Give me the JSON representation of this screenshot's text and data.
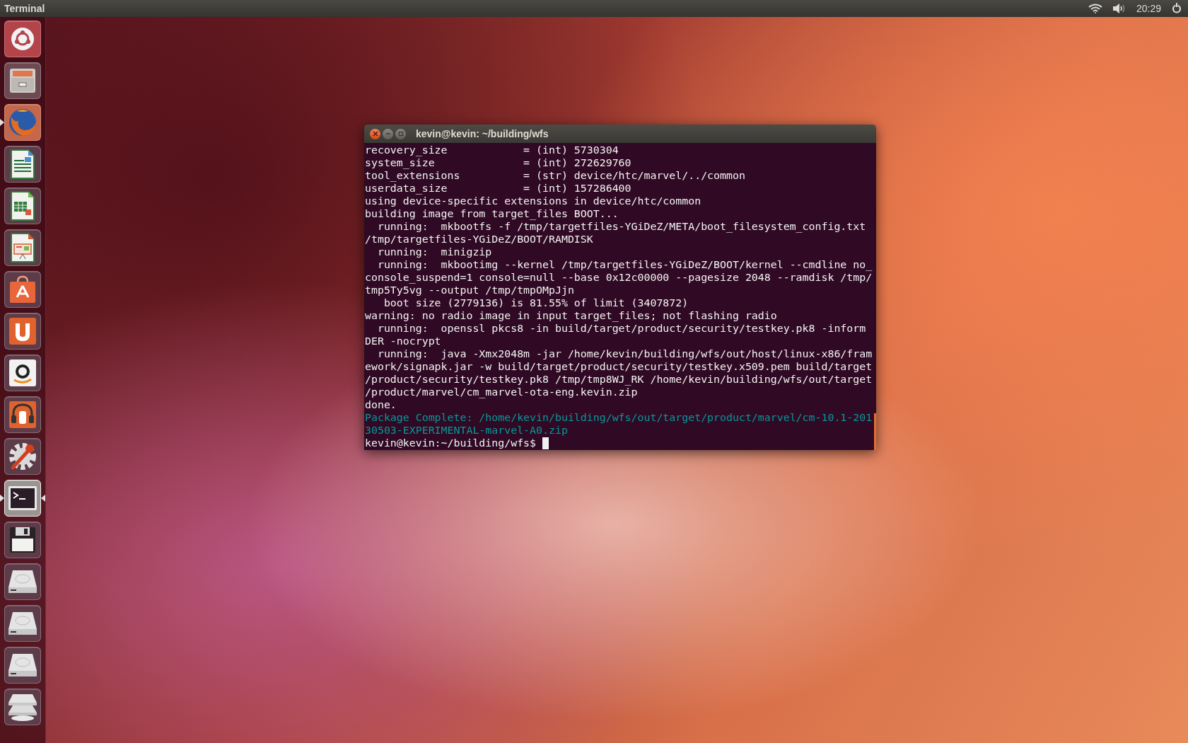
{
  "top_bar": {
    "app_title": "Terminal",
    "clock": "20:29"
  },
  "launcher": [
    {
      "kind": "ubuntu",
      "running": false,
      "focused": false
    },
    {
      "kind": "files",
      "running": false,
      "focused": false
    },
    {
      "kind": "browser",
      "running": true,
      "focused": false
    },
    {
      "kind": "writer",
      "running": false,
      "focused": false
    },
    {
      "kind": "calc",
      "running": false,
      "focused": false
    },
    {
      "kind": "impress",
      "running": false,
      "focused": false
    },
    {
      "kind": "software",
      "running": false,
      "focused": false
    },
    {
      "kind": "cloud",
      "running": false,
      "focused": false
    },
    {
      "kind": "shop",
      "running": false,
      "focused": false
    },
    {
      "kind": "music",
      "running": false,
      "focused": false
    },
    {
      "kind": "settings",
      "running": false,
      "focused": false
    },
    {
      "kind": "terminal",
      "running": true,
      "focused": true
    },
    {
      "kind": "floppy",
      "running": false,
      "focused": false
    },
    {
      "kind": "drive",
      "running": false,
      "focused": false
    },
    {
      "kind": "drive",
      "running": false,
      "focused": false
    },
    {
      "kind": "drive",
      "running": false,
      "focused": false
    },
    {
      "kind": "stack",
      "running": false,
      "focused": false
    }
  ],
  "terminal": {
    "title": "kevin@kevin: ~/building/wfs",
    "lines": [
      {
        "kind": "output",
        "text": "recovery_size            = (int) 5730304"
      },
      {
        "kind": "output",
        "text": "system_size              = (int) 272629760"
      },
      {
        "kind": "output",
        "text": "tool_extensions          = (str) device/htc/marvel/../common"
      },
      {
        "kind": "output",
        "text": "userdata_size            = (int) 157286400"
      },
      {
        "kind": "output",
        "text": "using device-specific extensions in device/htc/common"
      },
      {
        "kind": "output",
        "text": "building image from target_files BOOT..."
      },
      {
        "kind": "output",
        "text": "  running:  mkbootfs -f /tmp/targetfiles-YGiDeZ/META/boot_filesystem_config.txt"
      },
      {
        "kind": "output",
        "text": "/tmp/targetfiles-YGiDeZ/BOOT/RAMDISK"
      },
      {
        "kind": "output",
        "text": "  running:  minigzip"
      },
      {
        "kind": "output",
        "text": "  running:  mkbootimg --kernel /tmp/targetfiles-YGiDeZ/BOOT/kernel --cmdline no_"
      },
      {
        "kind": "output",
        "text": "console_suspend=1 console=null --base 0x12c00000 --pagesize 2048 --ramdisk /tmp/"
      },
      {
        "kind": "output",
        "text": "tmp5Ty5vg --output /tmp/tmpOMpJjn"
      },
      {
        "kind": "output",
        "text": "   boot size (2779136) is 81.55% of limit (3407872)"
      },
      {
        "kind": "output",
        "text": "warning: no radio image in input target_files; not flashing radio"
      },
      {
        "kind": "output",
        "text": "  running:  openssl pkcs8 -in build/target/product/security/testkey.pk8 -inform"
      },
      {
        "kind": "output",
        "text": "DER -nocrypt"
      },
      {
        "kind": "output",
        "text": "  running:  java -Xmx2048m -jar /home/kevin/building/wfs/out/host/linux-x86/fram"
      },
      {
        "kind": "output",
        "text": "ework/signapk.jar -w build/target/product/security/testkey.x509.pem build/target"
      },
      {
        "kind": "output",
        "text": "/product/security/testkey.pk8 /tmp/tmp8WJ_RK /home/kevin/building/wfs/out/target"
      },
      {
        "kind": "output",
        "text": "/product/marvel/cm_marvel-ota-eng.kevin.zip"
      },
      {
        "kind": "output",
        "text": "done."
      },
      {
        "kind": "highlight",
        "text": "Package Complete: /home/kevin/building/wfs/out/target/product/marvel/cm-10.1-201"
      },
      {
        "kind": "highlight",
        "text": "30503-EXPERIMENTAL-marvel-A0.zip"
      },
      {
        "kind": "prompt",
        "text": "kevin@kevin:~/building/wfs$ "
      }
    ]
  }
}
